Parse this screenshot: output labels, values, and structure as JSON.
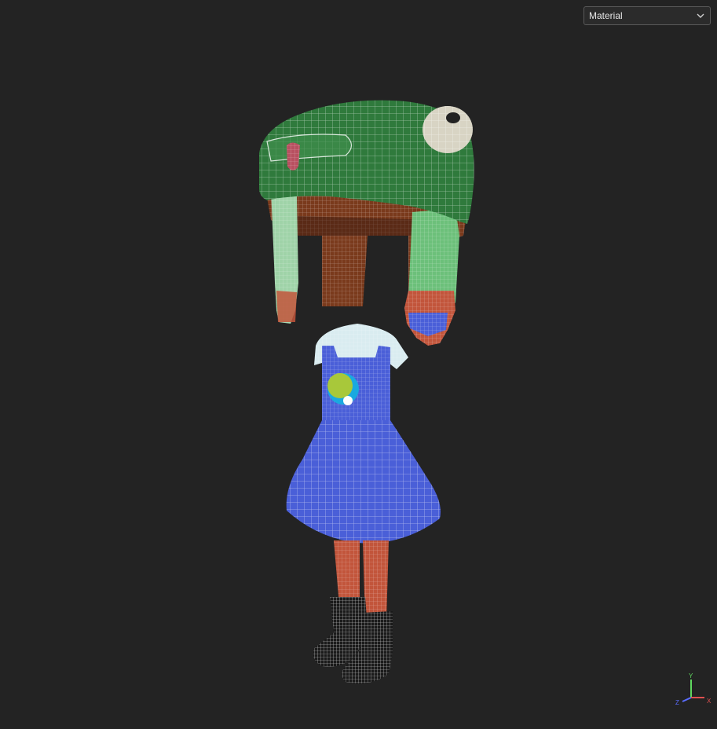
{
  "toolbar": {
    "render_mode": {
      "selected": "Material",
      "icon": "chevron-down-icon"
    }
  },
  "axis_gizmo": {
    "labels": {
      "y": "Y",
      "x": "X",
      "z": "Z"
    },
    "colors": {
      "y": "#5fd85f",
      "x": "#e05050",
      "z": "#5a6cff"
    }
  },
  "model": {
    "hat_color": "#2f7a3c",
    "hair_color": "#7a3a1c",
    "dress_color": "#4a5fd8",
    "shirt_color": "#d9ecf0",
    "skin_color": "#c2553b",
    "boot_color": "#1a1a1a"
  }
}
